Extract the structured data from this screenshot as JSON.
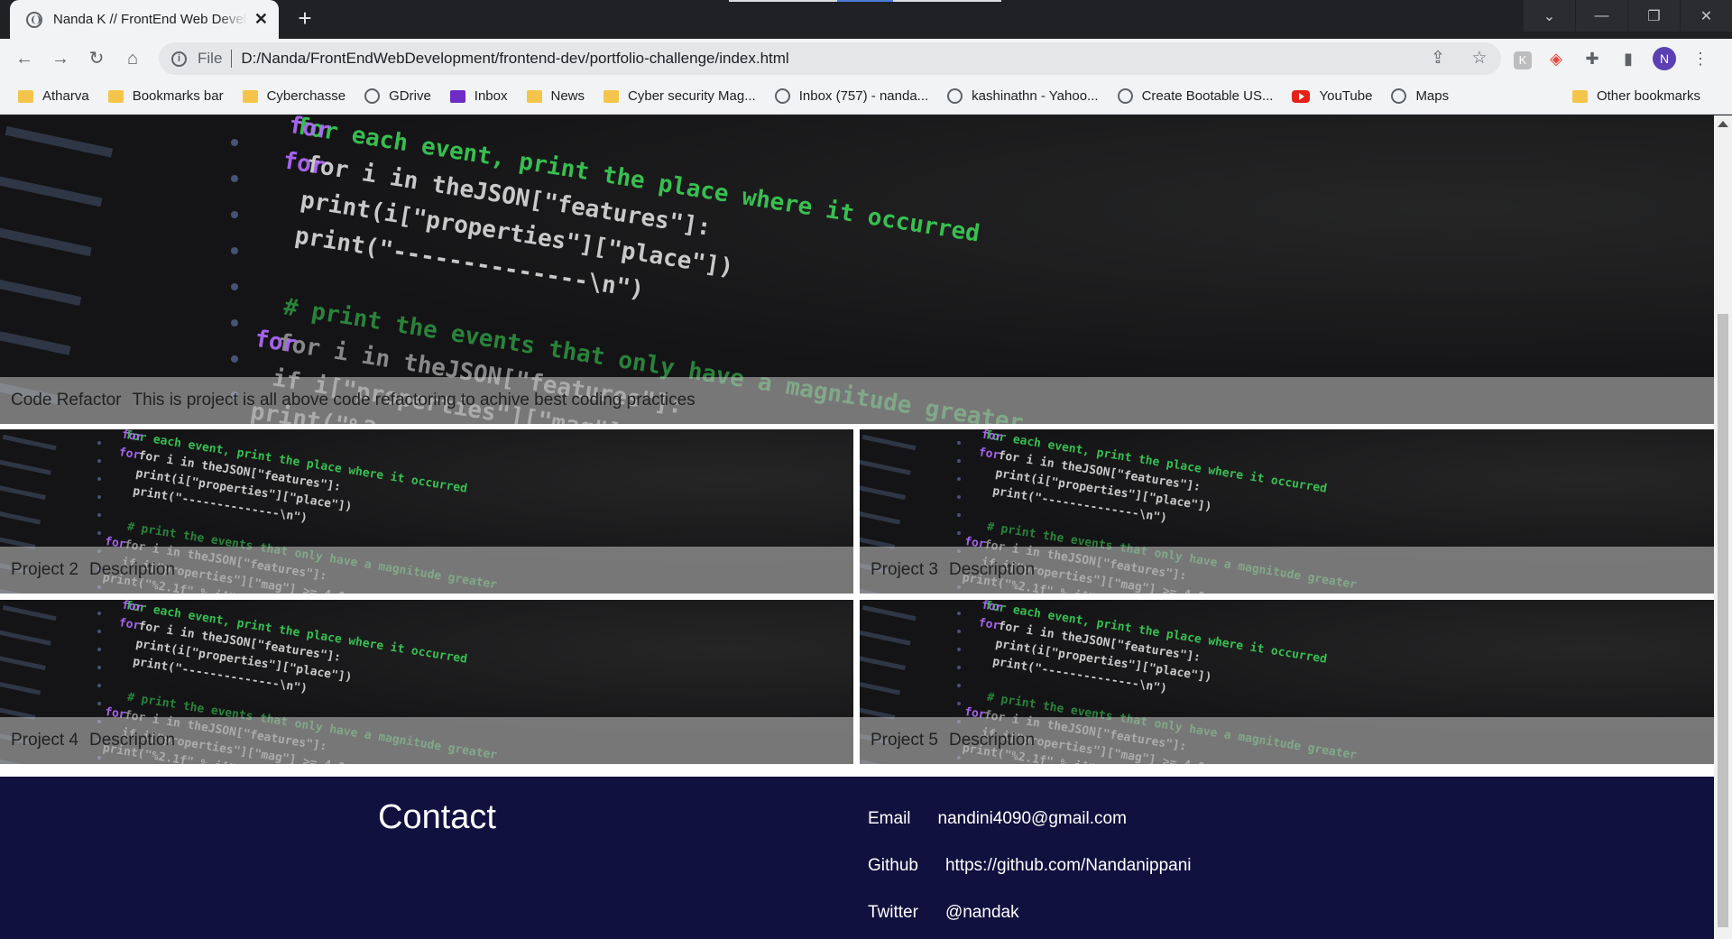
{
  "browser": {
    "tab_title": "Nanda K // FrontEnd Web Developer",
    "tab_close": "✕",
    "new_tab": "+",
    "file_label": "File",
    "url": "D:/Nanda/FrontEndWebDevelopment/frontend-dev/portfolio-challenge/index.html",
    "avatar_initial": "N",
    "bookmarks": [
      {
        "label": "Atharva",
        "icon": "folder"
      },
      {
        "label": "Bookmarks bar",
        "icon": "folder"
      },
      {
        "label": "Cyberchasse",
        "icon": "folder"
      },
      {
        "label": "GDrive",
        "icon": "globe"
      },
      {
        "label": "Inbox",
        "icon": "mail"
      },
      {
        "label": "News",
        "icon": "folder"
      },
      {
        "label": "Cyber security Mag...",
        "icon": "folder"
      },
      {
        "label": "Inbox (757) - nanda...",
        "icon": "globe"
      },
      {
        "label": "kashinathn - Yahoo...",
        "icon": "globe"
      },
      {
        "label": "Create Bootable US...",
        "icon": "globe"
      },
      {
        "label": "YouTube",
        "icon": "youtube"
      },
      {
        "label": "Maps",
        "icon": "globe"
      }
    ],
    "other_bookmarks": "Other bookmarks"
  },
  "projects": {
    "featured": {
      "title": "Code Refactor",
      "description": "This is project is all above code refactoring to achive best coding practices"
    },
    "items": [
      {
        "title": "Project 2",
        "description": "Description"
      },
      {
        "title": "Project 3",
        "description": "Description"
      },
      {
        "title": "Project 4",
        "description": "Description"
      },
      {
        "title": "Project 5",
        "description": "Description"
      }
    ]
  },
  "contact": {
    "heading": "Contact",
    "email_label": "Email",
    "email": "nandini4090@gmail.com",
    "github_label": "Github",
    "github": "https://github.com/Nandanippani",
    "twitter_label": "Twitter",
    "twitter": "@nandak"
  },
  "colors": {
    "contact_bg": "#11113f",
    "code_green": "#3ddc5a",
    "code_purple": "#b46cff"
  }
}
